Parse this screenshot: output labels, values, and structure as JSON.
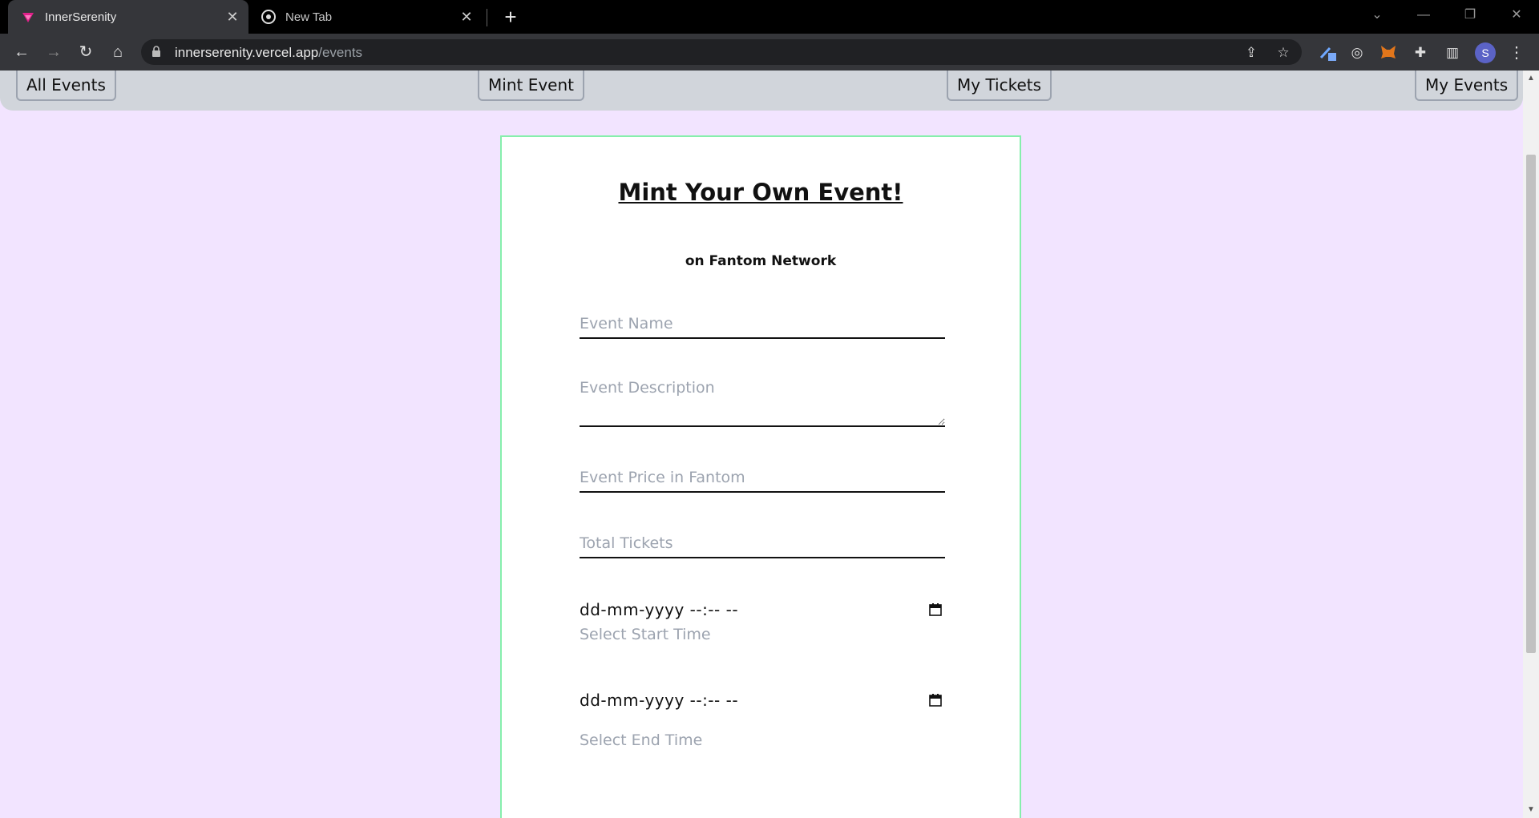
{
  "browser": {
    "tabs": [
      {
        "title": "InnerSerenity",
        "close": "✕"
      },
      {
        "title": "New Tab",
        "close": "✕"
      }
    ],
    "new_tab": "+",
    "url_host": "innerserenity.vercel.app",
    "url_path": "/events",
    "profile_initial": "S",
    "colors": {
      "tab_active": "#35363a",
      "toolbar": "#35363a",
      "omnibox": "#202124"
    }
  },
  "nav": {
    "links": [
      "All Events",
      "Mint Event",
      "My Tickets",
      "My Events"
    ]
  },
  "form": {
    "title": "Mint Your Own Event!",
    "subtitle": "on Fantom Network",
    "event_name_placeholder": "Event Name",
    "event_description_placeholder": "Event Description",
    "event_price_placeholder": "Event Price in Fantom",
    "total_tickets_placeholder": "Total Tickets",
    "start_datetime": "dd-mm-yyyy --:-- --",
    "start_hint": "Select Start Time",
    "end_datetime": "dd-mm-yyyy --:-- --",
    "end_hint": "Select End Time"
  },
  "colors": {
    "page_bg": "#f2e4ff",
    "navbar_bg": "#d1d5db",
    "card_border": "#86efac"
  }
}
